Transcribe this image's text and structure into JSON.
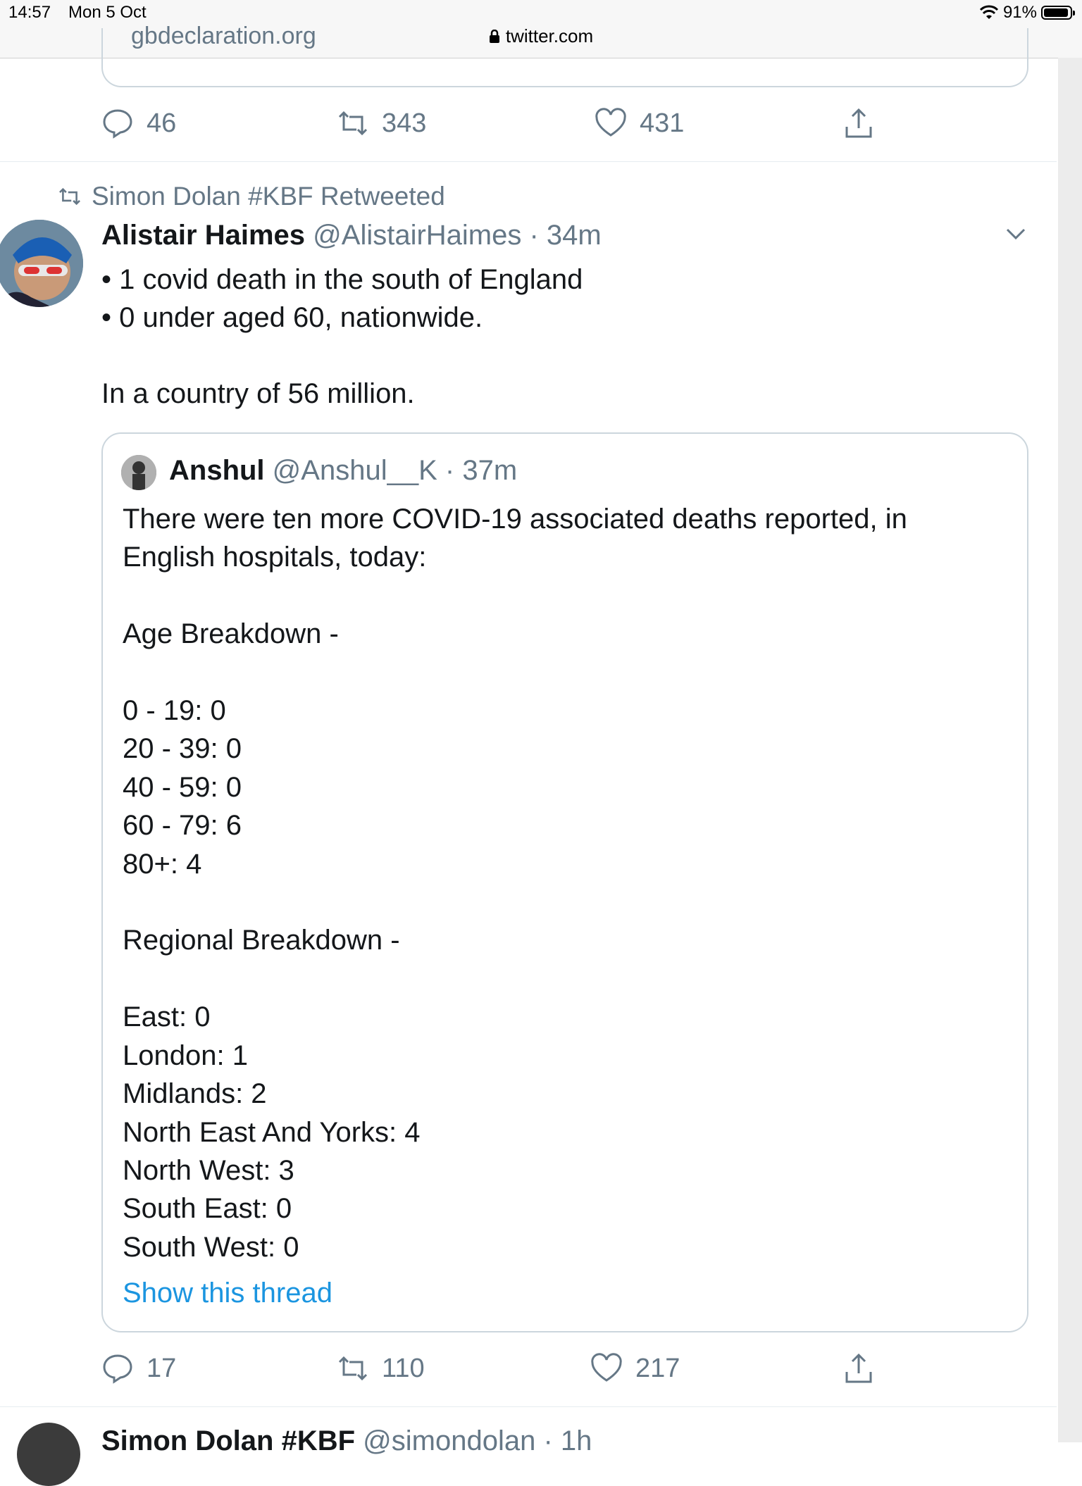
{
  "status_bar": {
    "time": "14:57",
    "date": "Mon 5 Oct",
    "battery": "91%",
    "url": "twitter.com"
  },
  "previous_tweet": {
    "card_link_text": "gbdeclaration.org",
    "replies": "46",
    "retweets": "343",
    "likes": "431"
  },
  "tweet": {
    "retweeted_by": "Simon Dolan #KBF Retweeted",
    "author_name": "Alistair Haimes",
    "author_handle": "@AlistairHaimes",
    "time_ago": "· 34m",
    "text": "• 1 covid death in the south of England\n• 0 under aged 60, nationwide.\n\nIn a country of 56 million.",
    "quoted": {
      "author_name": "Anshul",
      "author_handle": "@Anshul__K",
      "time_ago": "· 37m",
      "text": "There were ten more COVID-19 associated deaths reported, in\nEnglish hospitals, today:\n\nAge Breakdown -\n\n0 - 19: 0\n20 - 39: 0\n40 - 59: 0\n60 - 79: 6\n80+: 4\n\nRegional Breakdown -\n\nEast: 0\nLondon: 1\nMidlands: 2\nNorth East And Yorks: 4\nNorth West: 3\nSouth East: 0\nSouth West: 0",
      "show_thread": "Show this thread"
    },
    "replies": "17",
    "retweets": "110",
    "likes": "217"
  },
  "next_tweet": {
    "author_name": "Simon Dolan #KBF",
    "author_handle": "@simondolan",
    "time_ago": "· 1h"
  },
  "colors": {
    "text": "#14171a",
    "secondary": "#657786",
    "link": "#1b95e0",
    "border": "#ccd6dd"
  }
}
